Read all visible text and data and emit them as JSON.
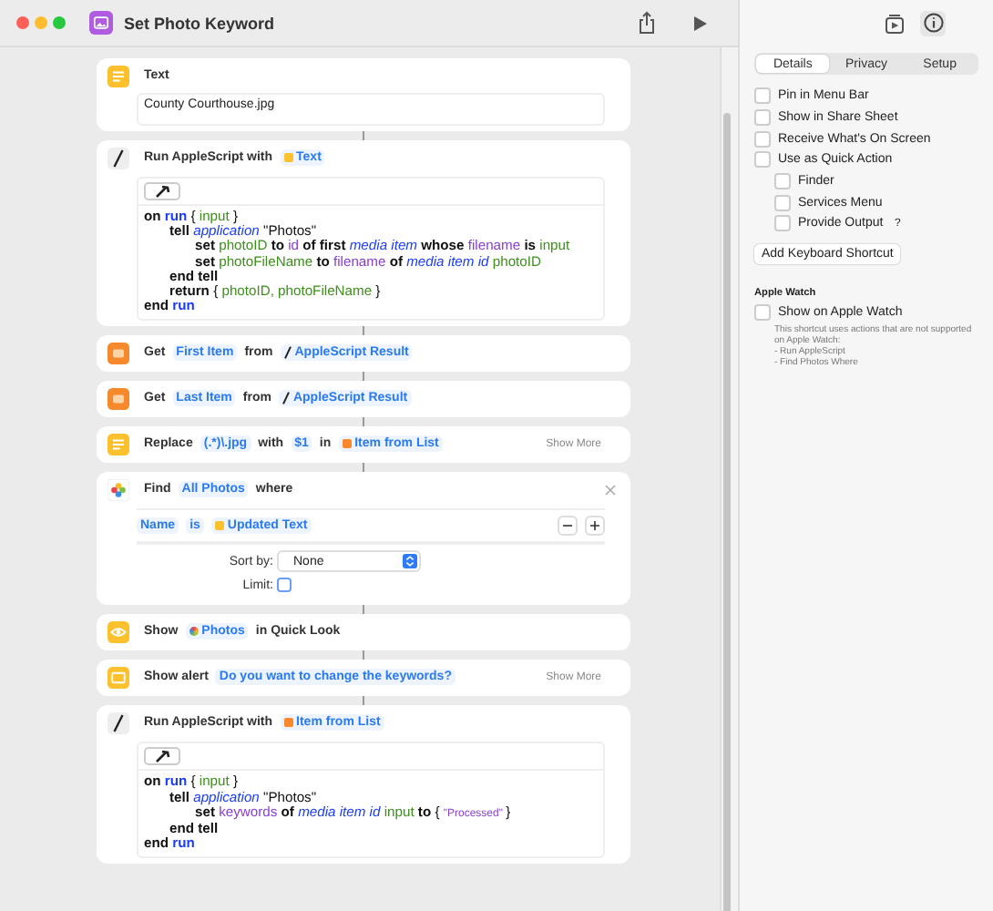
{
  "window": {
    "title": "Set Photo Keyword"
  },
  "actions": [
    {
      "kind": "text",
      "header": [
        {
          "kind": "word",
          "text": "Text"
        }
      ],
      "value": "County Courthouse.jpg"
    },
    {
      "kind": "script",
      "header": [
        {
          "kind": "word",
          "text": "Run AppleScript with"
        },
        {
          "kind": "var-text",
          "text": "Text"
        }
      ],
      "code": [
        {
          "tokens": [
            {
              "kind": "kw",
              "text": "on"
            },
            {
              "kind": "cmd",
              "text": "run"
            },
            {
              "kind": "plain",
              "text": "{"
            },
            {
              "kind": "var",
              "text": "input"
            },
            {
              "kind": "plain",
              "text": "}"
            }
          ],
          "children": [
            {
              "tokens": [
                {
                  "kind": "kw",
                  "text": "tell"
                },
                {
                  "kind": "class",
                  "text": "application"
                },
                {
                  "kind": "plain",
                  "text": "\"Photos\""
                }
              ],
              "children": [
                {
                  "tokens": [
                    {
                      "kind": "kw",
                      "text": "set"
                    },
                    {
                      "kind": "var",
                      "text": "photoID"
                    },
                    {
                      "kind": "kw",
                      "text": "to"
                    },
                    {
                      "kind": "prop",
                      "text": "id"
                    },
                    {
                      "kind": "kw",
                      "text": "of first"
                    },
                    {
                      "kind": "class",
                      "text": "media item"
                    },
                    {
                      "kind": "kw",
                      "text": "whose"
                    },
                    {
                      "kind": "prop",
                      "text": "filename"
                    },
                    {
                      "kind": "kw",
                      "text": "is"
                    },
                    {
                      "kind": "var",
                      "text": "input"
                    }
                  ]
                },
                {
                  "tokens": [
                    {
                      "kind": "kw",
                      "text": "set"
                    },
                    {
                      "kind": "var",
                      "text": "photoFileName"
                    },
                    {
                      "kind": "kw",
                      "text": "to"
                    },
                    {
                      "kind": "prop",
                      "text": "filename"
                    },
                    {
                      "kind": "kw",
                      "text": "of"
                    },
                    {
                      "kind": "class",
                      "text": "media item id"
                    },
                    {
                      "kind": "var",
                      "text": "photoID"
                    }
                  ]
                }
              ]
            },
            {
              "tokens": [
                {
                  "kind": "kw",
                  "text": "end tell"
                }
              ]
            },
            {
              "tokens": [
                {
                  "kind": "kw",
                  "text": "return"
                },
                {
                  "kind": "plain",
                  "text": "{"
                },
                {
                  "kind": "var",
                  "text": "photoID,"
                },
                {
                  "kind": "var",
                  "text": "photoFileName"
                },
                {
                  "kind": "plain",
                  "text": "}"
                }
              ]
            }
          ]
        },
        {
          "tokens": [
            {
              "kind": "kw",
              "text": "end"
            },
            {
              "kind": "cmd",
              "text": "run"
            }
          ]
        }
      ]
    },
    {
      "kind": "get",
      "header": [
        {
          "kind": "word",
          "text": "Get"
        },
        {
          "kind": "param",
          "text": "First Item"
        },
        {
          "kind": "word",
          "text": "from"
        },
        {
          "kind": "var-script",
          "text": "AppleScript Result"
        }
      ]
    },
    {
      "kind": "get",
      "header": [
        {
          "kind": "word",
          "text": "Get"
        },
        {
          "kind": "param",
          "text": "Last Item"
        },
        {
          "kind": "word",
          "text": "from"
        },
        {
          "kind": "var-script",
          "text": "AppleScript Result"
        }
      ]
    },
    {
      "kind": "replace",
      "header": [
        {
          "kind": "word",
          "text": "Replace"
        },
        {
          "kind": "param",
          "text": "(.*)\\.jpg"
        },
        {
          "kind": "word",
          "text": "with"
        },
        {
          "kind": "param",
          "text": "$1"
        },
        {
          "kind": "word",
          "text": "in"
        },
        {
          "kind": "var-list",
          "text": "Item from List"
        }
      ],
      "show_more": "Show More"
    },
    {
      "kind": "find",
      "header": [
        {
          "kind": "word",
          "text": "Find"
        },
        {
          "kind": "param",
          "text": "All Photos"
        },
        {
          "kind": "word",
          "text": "where"
        }
      ],
      "filter": [
        {
          "kind": "param",
          "text": "Name"
        },
        {
          "kind": "param",
          "text": "is"
        },
        {
          "kind": "var-text",
          "text": "Updated Text"
        }
      ],
      "sort_label": "Sort by:",
      "sort_value": "None",
      "limit_label": "Limit:",
      "limit_checked": false
    },
    {
      "kind": "show",
      "header": [
        {
          "kind": "word",
          "text": "Show"
        },
        {
          "kind": "var-photos",
          "text": "Photos"
        },
        {
          "kind": "word",
          "text": "in Quick Look"
        }
      ]
    },
    {
      "kind": "alert",
      "header": [
        {
          "kind": "word",
          "text": "Show alert"
        },
        {
          "kind": "param",
          "text": "Do you want to change the keywords?"
        }
      ],
      "show_more": "Show More"
    },
    {
      "kind": "script",
      "header": [
        {
          "kind": "word",
          "text": "Run AppleScript with"
        },
        {
          "kind": "var-list",
          "text": "Item from List"
        }
      ],
      "code": [
        {
          "tokens": [
            {
              "kind": "kw",
              "text": "on"
            },
            {
              "kind": "cmd",
              "text": "run"
            },
            {
              "kind": "plain",
              "text": "{"
            },
            {
              "kind": "var",
              "text": "input"
            },
            {
              "kind": "plain",
              "text": "}"
            }
          ],
          "children": [
            {
              "tokens": [
                {
                  "kind": "kw",
                  "text": "tell"
                },
                {
                  "kind": "class",
                  "text": "application"
                },
                {
                  "kind": "plain",
                  "text": "\"Photos\""
                }
              ],
              "children": [
                {
                  "tokens": [
                    {
                      "kind": "kw",
                      "text": "set"
                    },
                    {
                      "kind": "prop",
                      "text": "keywords"
                    },
                    {
                      "kind": "kw",
                      "text": "of"
                    },
                    {
                      "kind": "class",
                      "text": "media item id"
                    },
                    {
                      "kind": "var",
                      "text": "input"
                    },
                    {
                      "kind": "kw",
                      "text": "to"
                    },
                    {
                      "kind": "plain",
                      "text": "{"
                    },
                    {
                      "kind": "str",
                      "text": "\"Processed\""
                    },
                    {
                      "kind": "plain",
                      "text": "}"
                    }
                  ]
                }
              ]
            },
            {
              "tokens": [
                {
                  "kind": "kw",
                  "text": "end tell"
                }
              ]
            }
          ]
        },
        {
          "tokens": [
            {
              "kind": "kw",
              "text": "end"
            },
            {
              "kind": "cmd",
              "text": "run"
            }
          ]
        }
      ]
    }
  ],
  "inspector": {
    "tabs": [
      {
        "label": "Details",
        "selected": true
      },
      {
        "label": "Privacy",
        "selected": false
      },
      {
        "label": "Setup",
        "selected": false
      }
    ],
    "options": [
      {
        "label": "Pin in Menu Bar",
        "checked": false
      },
      {
        "label": "Show in Share Sheet",
        "checked": false
      },
      {
        "label": "Receive What's On Screen",
        "checked": false
      },
      {
        "label": "Use as Quick Action",
        "checked": false,
        "children": [
          {
            "label": "Finder",
            "checked": false
          },
          {
            "label": "Services Menu",
            "checked": false
          },
          {
            "label": "Provide Output",
            "checked": false,
            "help": "?"
          }
        ]
      }
    ],
    "shortcut_button": "Add Keyboard Shortcut",
    "watch_heading": "Apple Watch",
    "watch_option": {
      "label": "Show on Apple Watch",
      "checked": false
    },
    "watch_note": [
      "This shortcut uses actions that are not supported on Apple Watch:",
      "- Run AppleScript",
      "- Find Photos Where"
    ]
  }
}
